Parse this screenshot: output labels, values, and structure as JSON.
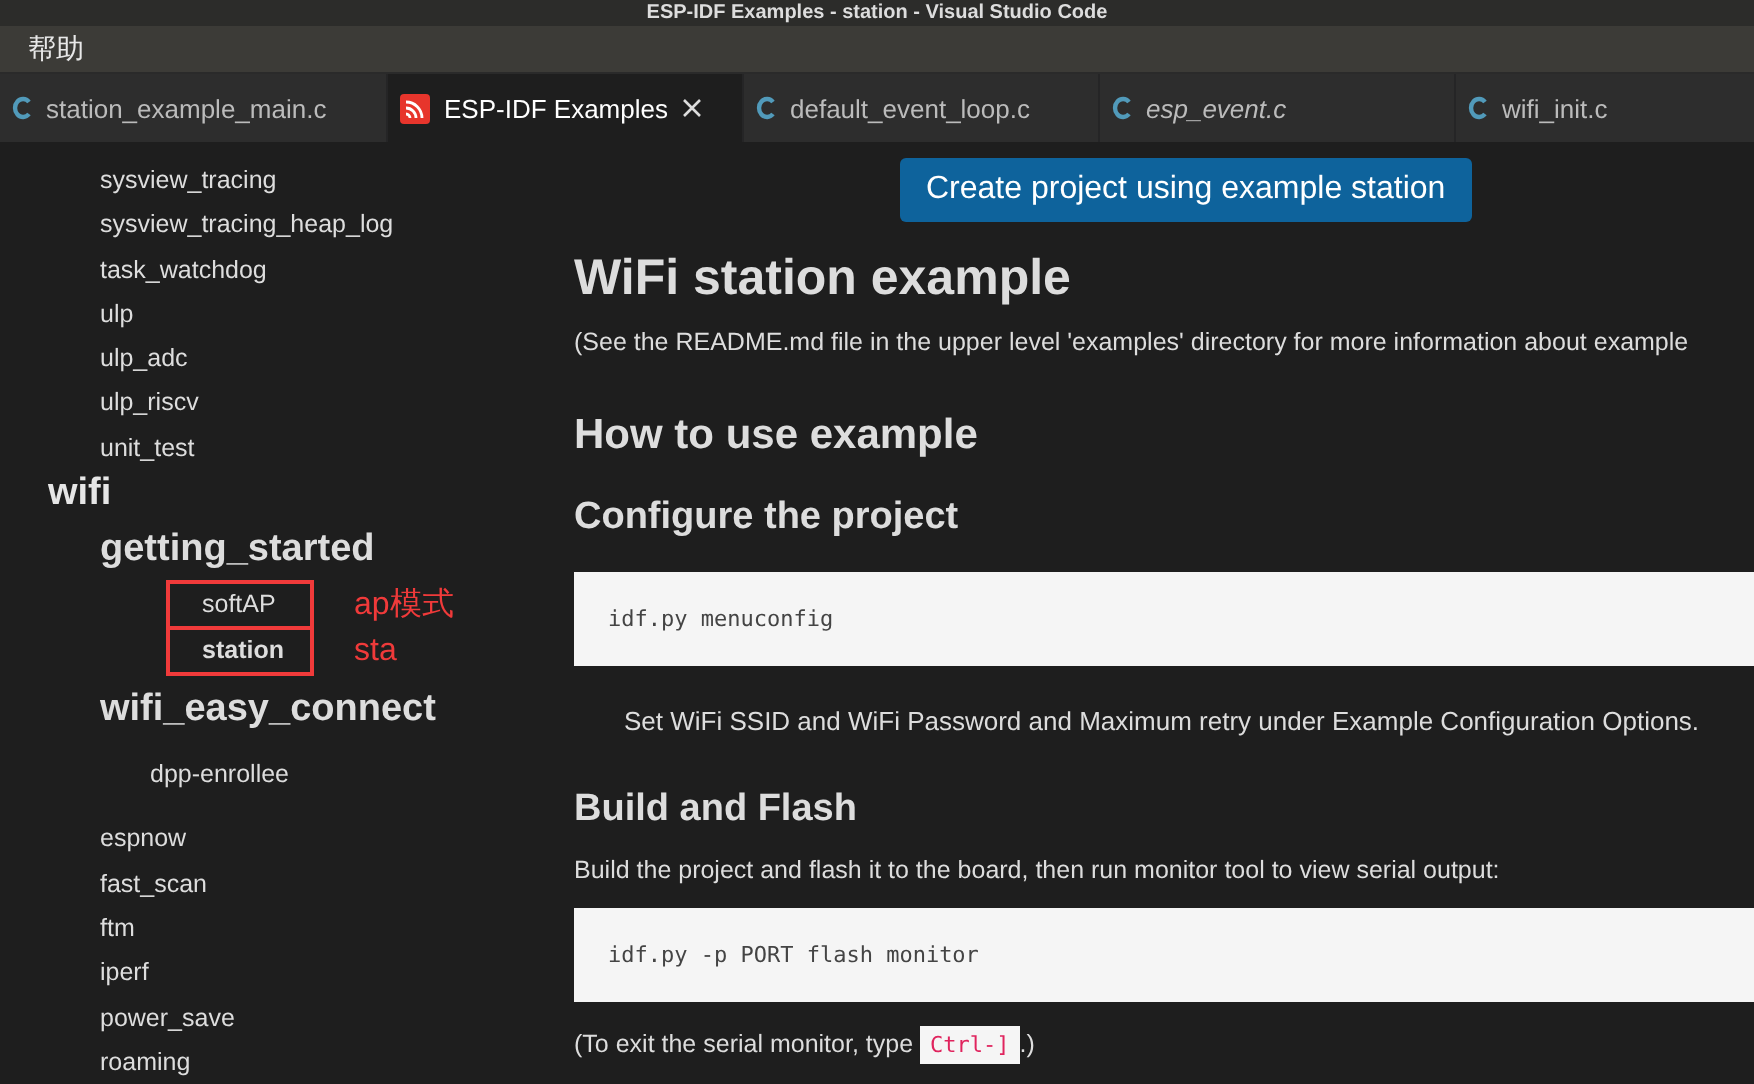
{
  "window": {
    "title": "ESP-IDF Examples - station - Visual Studio Code"
  },
  "menu": [
    "帮助"
  ],
  "tabs": [
    {
      "label": "station_example_main.c",
      "kind": "c",
      "selected": false,
      "preview": false
    },
    {
      "label": "ESP-IDF Examples",
      "kind": "esp",
      "selected": true,
      "preview": false
    },
    {
      "label": "default_event_loop.c",
      "kind": "c",
      "selected": false,
      "preview": false
    },
    {
      "label": "esp_event.c",
      "kind": "c",
      "selected": false,
      "preview": true
    },
    {
      "label": "wifi_init.c",
      "kind": "c",
      "selected": false,
      "preview": false
    }
  ],
  "sidebar": {
    "items": [
      {
        "kind": "example",
        "label": "sysview_tracing",
        "selected": false
      },
      {
        "kind": "example",
        "label": "sysview_tracing_heap_log",
        "selected": false
      },
      {
        "kind": "example",
        "label": "task_watchdog",
        "selected": false
      },
      {
        "kind": "example",
        "label": "ulp",
        "selected": false
      },
      {
        "kind": "example",
        "label": "ulp_adc",
        "selected": false
      },
      {
        "kind": "example",
        "label": "ulp_riscv",
        "selected": false
      },
      {
        "kind": "example",
        "label": "unit_test",
        "selected": false
      },
      {
        "kind": "category",
        "label": "wifi",
        "children": [
          {
            "kind": "group",
            "label": "getting_started",
            "children": [
              {
                "kind": "example",
                "label": "softAP",
                "selected": false,
                "note": "ap模式"
              },
              {
                "kind": "example",
                "label": "station",
                "selected": true,
                "note": "sta"
              }
            ]
          },
          {
            "kind": "group",
            "label": "wifi_easy_connect",
            "children": [
              {
                "kind": "example",
                "label": "dpp-enrollee",
                "selected": false
              }
            ]
          },
          {
            "kind": "example",
            "label": "espnow",
            "selected": false
          },
          {
            "kind": "example",
            "label": "fast_scan",
            "selected": false
          },
          {
            "kind": "example",
            "label": "ftm",
            "selected": false
          },
          {
            "kind": "example",
            "label": "iperf",
            "selected": false
          },
          {
            "kind": "example",
            "label": "power_save",
            "selected": false
          },
          {
            "kind": "example",
            "label": "roaming",
            "selected": false
          }
        ]
      }
    ]
  },
  "content": {
    "button": "Create project using example station",
    "blocks": [
      {
        "kind": "h1",
        "text": "WiFi station example"
      },
      {
        "kind": "p",
        "text": "(See the README.md file in the upper level 'examples' directory for more information about example"
      },
      {
        "kind": "h2",
        "text": "How to use example"
      },
      {
        "kind": "h3",
        "text": "Configure the project"
      },
      {
        "kind": "code",
        "text": "idf.py menuconfig"
      },
      {
        "kind": "indent",
        "text": "Set WiFi SSID and WiFi Password and Maximum retry under Example Configuration Options."
      },
      {
        "kind": "h3",
        "text": "Build and Flash"
      },
      {
        "kind": "p",
        "text": "Build the project and flash it to the board, then run monitor tool to view serial output:"
      },
      {
        "kind": "code",
        "text": "idf.py -p PORT flash monitor"
      },
      {
        "kind": "inline",
        "before": "(To exit the serial monitor, type ",
        "code": "Ctrl-]",
        "after": ".)"
      }
    ]
  }
}
